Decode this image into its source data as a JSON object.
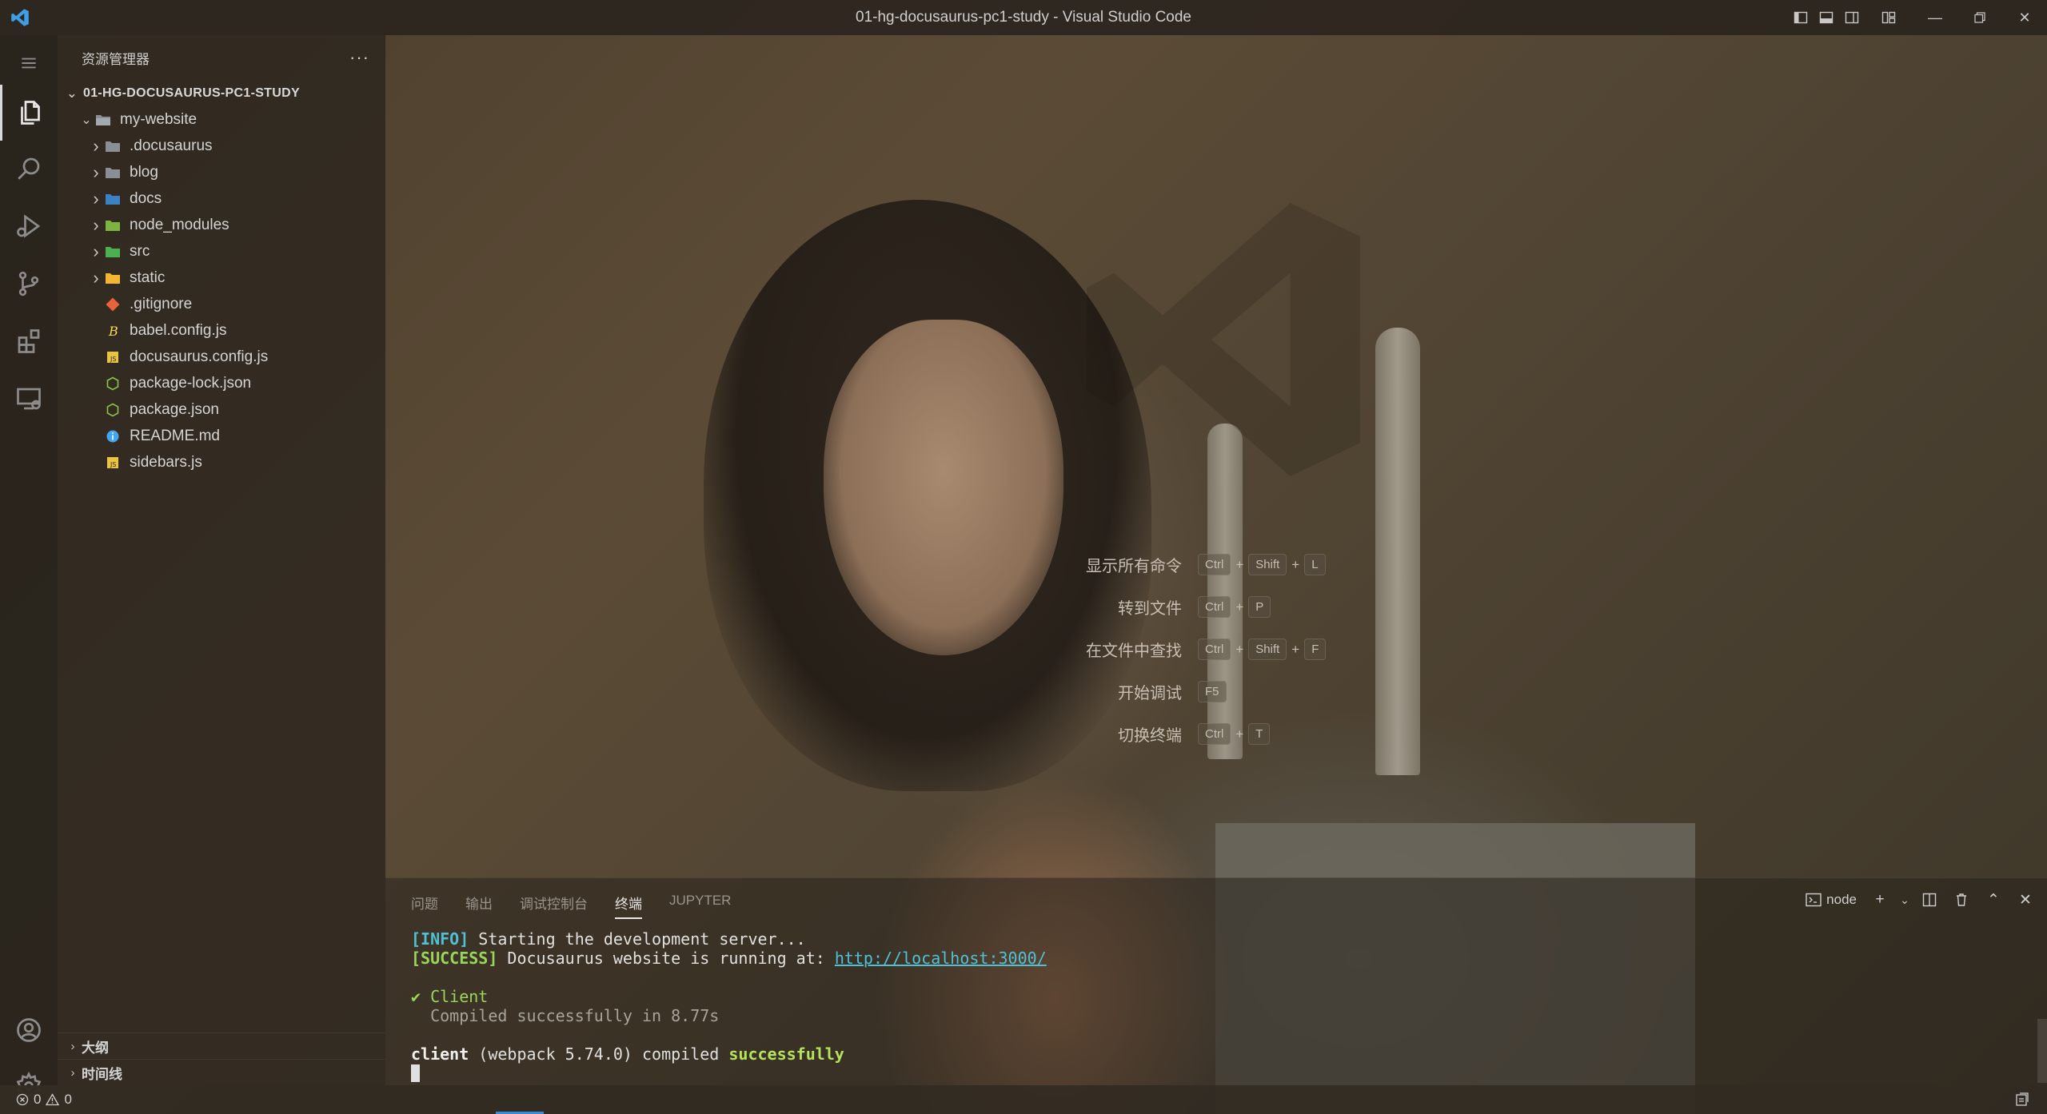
{
  "window": {
    "title": "01-hg-docusaurus-pc1-study - Visual Studio Code"
  },
  "explorer": {
    "title": "资源管理器",
    "more": "···",
    "root": "01-HG-DOCUSAURUS-PC1-STUDY",
    "folder": "my-website",
    "items": [
      {
        "name": ".docusaurus",
        "type": "folder",
        "icon": "folder-icon",
        "color": "#8a8f96"
      },
      {
        "name": "blog",
        "type": "folder",
        "icon": "folder-icon",
        "color": "#8a8f96"
      },
      {
        "name": "docs",
        "type": "folder",
        "icon": "folder-docs-icon",
        "color": "#3b82c4"
      },
      {
        "name": "node_modules",
        "type": "folder",
        "icon": "folder-node-icon",
        "color": "#7cb342"
      },
      {
        "name": "src",
        "type": "folder",
        "icon": "folder-src-icon",
        "color": "#4caf50"
      },
      {
        "name": "static",
        "type": "folder",
        "icon": "folder-static-icon",
        "color": "#f2b630"
      },
      {
        "name": ".gitignore",
        "type": "file",
        "icon": "git-icon",
        "color": "#e8623a"
      },
      {
        "name": "babel.config.js",
        "type": "file",
        "icon": "babel-icon",
        "color": "#f5da55"
      },
      {
        "name": "docusaurus.config.js",
        "type": "file",
        "icon": "js-icon",
        "color": "#e8c441"
      },
      {
        "name": "package-lock.json",
        "type": "file",
        "icon": "nodejs-icon",
        "color": "#8bc34a"
      },
      {
        "name": "package.json",
        "type": "file",
        "icon": "nodejs-icon",
        "color": "#8bc34a"
      },
      {
        "name": "README.md",
        "type": "file",
        "icon": "info-icon",
        "color": "#42a5f5"
      },
      {
        "name": "sidebars.js",
        "type": "file",
        "icon": "js-icon",
        "color": "#e8c441"
      }
    ],
    "outline": "大纲",
    "timeline": "时间线"
  },
  "shortcuts": [
    {
      "label": "显示所有命令",
      "keys": [
        "Ctrl",
        "Shift",
        "L"
      ]
    },
    {
      "label": "转到文件",
      "keys": [
        "Ctrl",
        "P"
      ]
    },
    {
      "label": "在文件中查找",
      "keys": [
        "Ctrl",
        "Shift",
        "F"
      ]
    },
    {
      "label": "开始调试",
      "keys": [
        "F5"
      ]
    },
    {
      "label": "切换终端",
      "keys": [
        "Ctrl",
        "T"
      ]
    }
  ],
  "panel": {
    "tabs": [
      "问题",
      "输出",
      "调试控制台",
      "终端",
      "JUPYTER"
    ],
    "active_tab": "终端",
    "terminal_name": "node"
  },
  "terminal": {
    "line1_tag": "[INFO]",
    "line1_text": " Starting the development server...",
    "line2_tag": "[SUCCESS]",
    "line2_text": " Docusaurus website is running at: ",
    "line2_url": "http://localhost:3000/",
    "line3_check": "✔ Client",
    "line4": "  Compiled successfully in 8.77s",
    "line5_a": "client",
    "line5_b": " (webpack 5.74.0) compiled ",
    "line5_c": "successfully"
  },
  "status": {
    "errors": "0",
    "warnings": "0"
  }
}
